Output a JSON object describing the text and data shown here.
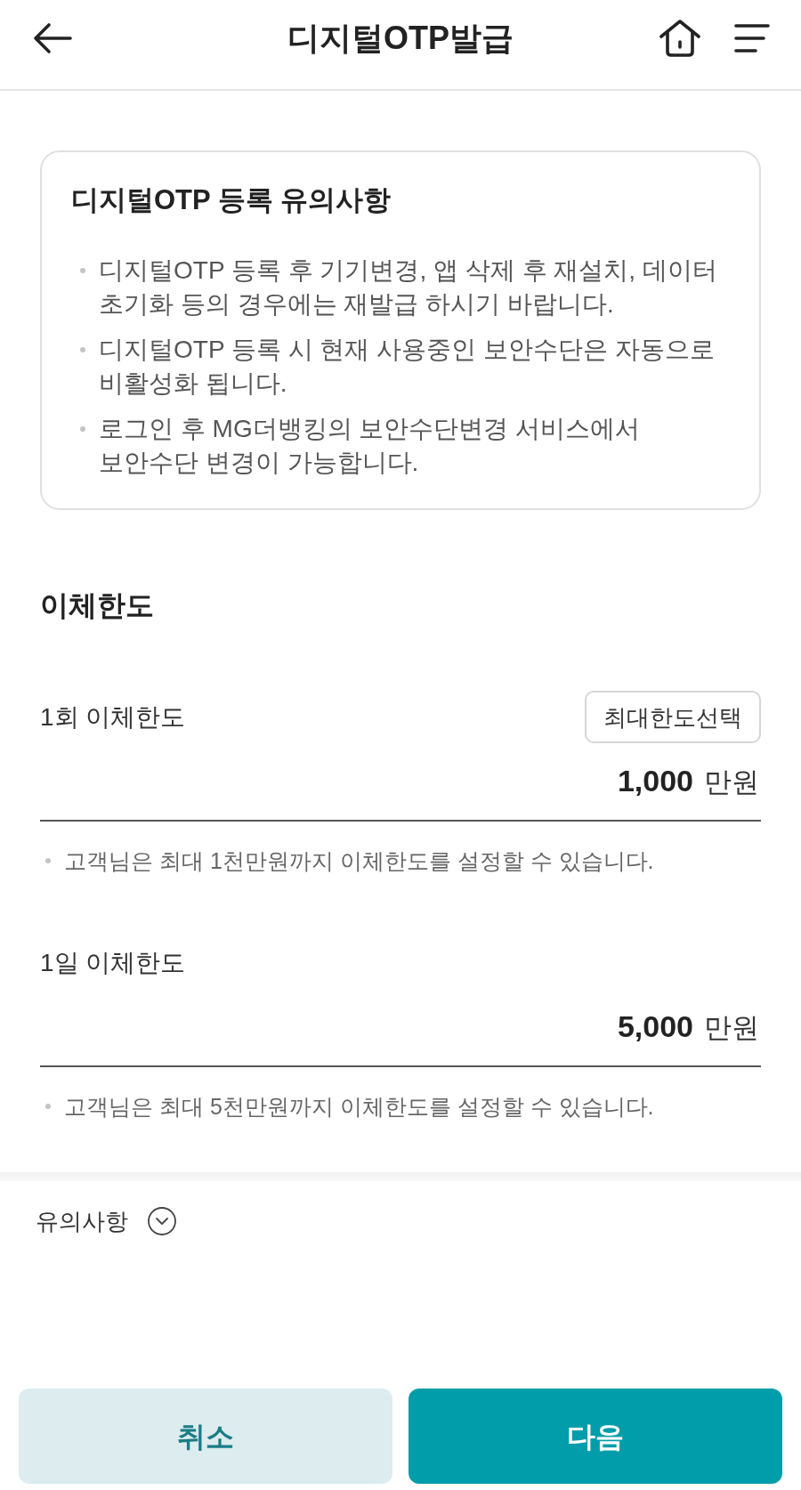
{
  "header": {
    "title": "디지털OTP발급"
  },
  "notice": {
    "title": "디지털OTP 등록 유의사항",
    "items": [
      "디지털OTP 등록 후 기기변경, 앱 삭제 후 재설치, 데이터 초기화 등의 경우에는 재발급 하시기 바랍니다.",
      "디지털OTP 등록 시 현재 사용중인 보안수단은 자동으로 비활성화 됩니다.",
      "로그인 후 MG더뱅킹의 보안수단변경 서비스에서 보안수단 변경이 가능합니다."
    ]
  },
  "transfer_limit": {
    "title": "이체한도",
    "fields": [
      {
        "label": "1회 이체한도",
        "button": "최대한도선택",
        "amount": "1,000",
        "unit": "만원",
        "hint": "고객님은 최대 1천만원까지 이체한도를 설정할 수 있습니다."
      },
      {
        "label": "1일 이체한도",
        "amount": "5,000",
        "unit": "만원",
        "hint": "고객님은 최대 5천만원까지 이체한도를 설정할 수 있습니다."
      }
    ]
  },
  "caution": {
    "label": "유의사항",
    "expanded": false
  },
  "buttons": [
    {
      "label": "취소",
      "kind": "secondary"
    },
    {
      "label": "다음",
      "kind": "primary"
    }
  ]
}
